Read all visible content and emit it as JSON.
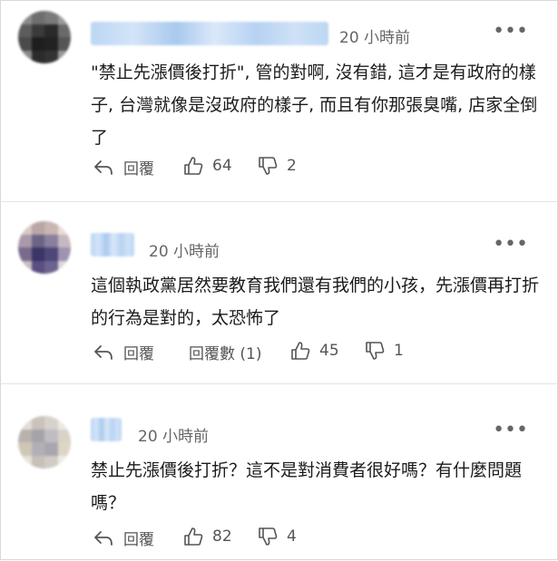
{
  "comments": [
    {
      "time": "20 小時前",
      "text": "\"禁止先漲價後打折\", 管的對啊, 沒有錯, 這才是有政府的樣子, 台灣就像是沒政府的樣子, 而且有你那張臭嘴, 店家全倒了",
      "reply_label": "回覆",
      "likes": "64",
      "dislikes": "2",
      "more_icon": "more-horizontal-icon"
    },
    {
      "time": "20 小時前",
      "text": "這個執政黨居然要教育我們還有我們的小孩，先漲價再打折的行為是對的，太恐怖了",
      "reply_label": "回覆",
      "reply_count_label": "回覆數 (1)",
      "likes": "45",
      "dislikes": "1",
      "more_icon": "more-horizontal-icon"
    },
    {
      "time": "20 小時前",
      "text": "禁止先漲價後打折？這不是對消費者很好嗎？有什麼問題嗎？",
      "reply_label": "回覆",
      "likes": "82",
      "dislikes": "4",
      "more_icon": "more-horizontal-icon"
    }
  ],
  "colors": {
    "text": "#1b1b1b",
    "meta": "#666666",
    "username_blur": "#bcd6f3",
    "divider": "#e4e4e4"
  }
}
